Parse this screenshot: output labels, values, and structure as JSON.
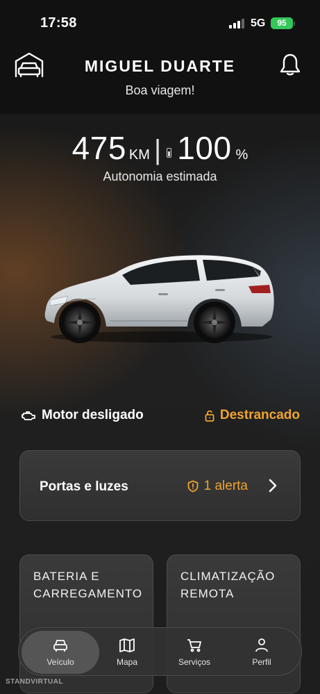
{
  "status_bar": {
    "time": "17:58",
    "network": "5G",
    "battery": "95"
  },
  "header": {
    "user_name": "MIGUEL DUARTE",
    "greeting": "Boa viagem!"
  },
  "range": {
    "distance": "475",
    "distance_unit": "KM",
    "separator": "|",
    "battery_level": "100",
    "battery_unit": "%",
    "caption": "Autonomia estimada"
  },
  "vehicle_status": {
    "engine": "Motor desligado",
    "lock": "Destrancado"
  },
  "doors_card": {
    "label": "Portas e luzes",
    "alert": "1 alerta"
  },
  "cards": [
    {
      "title": "BATERIA E CARREGAMENTO"
    },
    {
      "title": "CLIMATIZAÇÃO REMOTA"
    }
  ],
  "tabs": [
    {
      "label": "Veículo",
      "icon": "car-icon",
      "active": true
    },
    {
      "label": "Mapa",
      "icon": "map-icon",
      "active": false
    },
    {
      "label": "Serviços",
      "icon": "cart-icon",
      "active": false
    },
    {
      "label": "Perfil",
      "icon": "person-icon",
      "active": false
    }
  ],
  "watermark": "STANDVIRTUAL",
  "colors": {
    "accent": "#f0a431",
    "battery_green": "#34c759",
    "background": "#1a1a1a"
  }
}
